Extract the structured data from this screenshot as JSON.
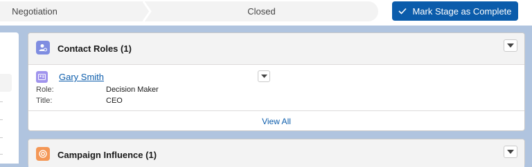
{
  "path": {
    "stages": [
      "Negotiation",
      "Closed"
    ],
    "mark_button_label": "Mark Stage as Complete"
  },
  "contact_roles": {
    "title": "Contact Roles (1)",
    "contact": {
      "name": "Gary Smith",
      "role_label": "Role:",
      "role_value": "Decision Maker",
      "title_label": "Title:",
      "title_value": "CEO"
    },
    "view_all": "View All"
  },
  "campaign_influence": {
    "title": "Campaign Influence (1)"
  },
  "colors": {
    "brand": "#0b5cab",
    "contact_roles_icon": "#7f8de1",
    "contact_icon": "#a094ed",
    "campaign_icon": "#f49756"
  }
}
